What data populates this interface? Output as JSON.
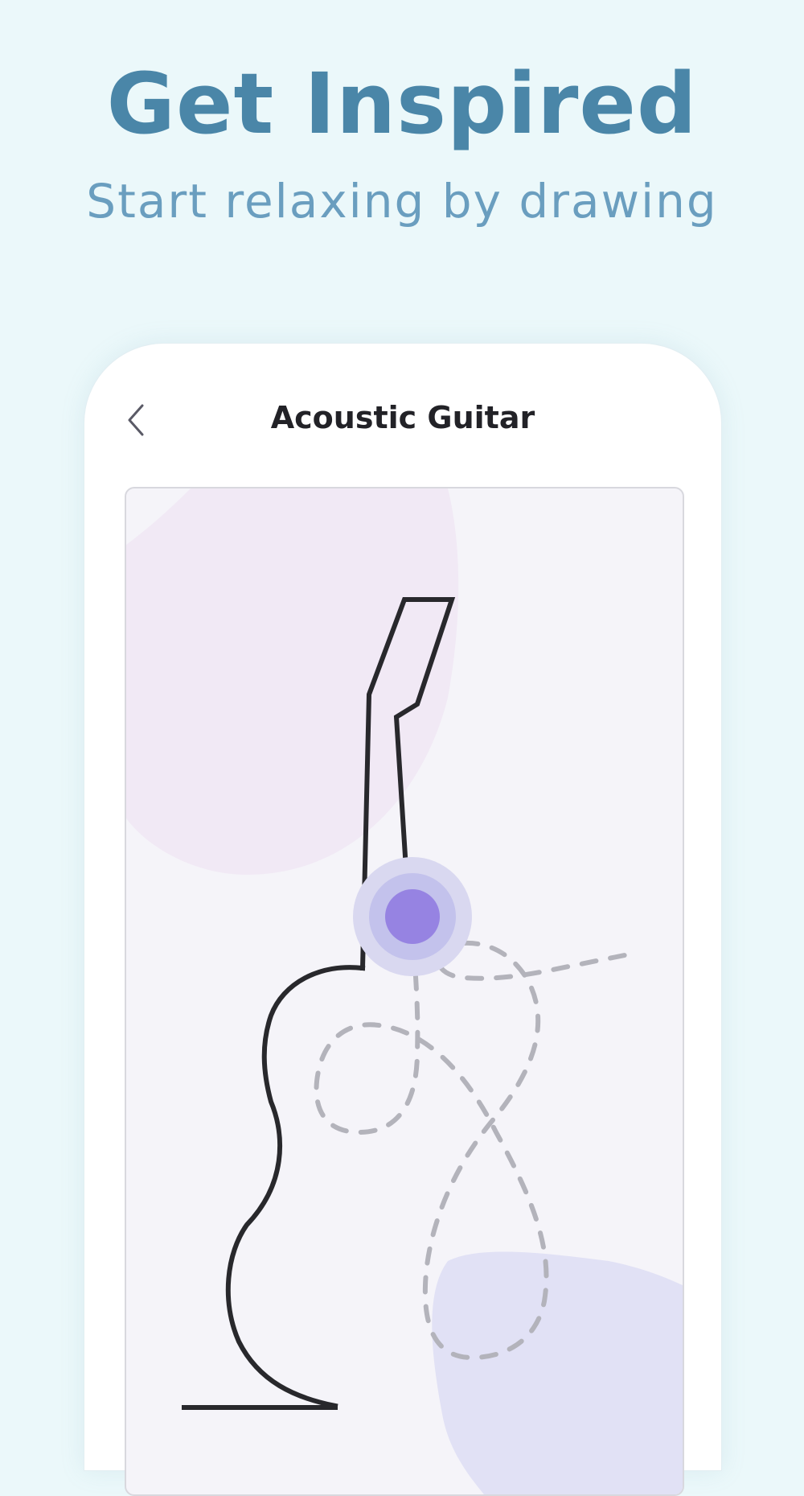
{
  "hero": {
    "title": "Get Inspired",
    "subtitle": "Start relaxing by drawing"
  },
  "app": {
    "title": "Acoustic Guitar",
    "back_icon": "chevron-left-icon"
  },
  "colors": {
    "background": "#ebf8fa",
    "title": "#4a86a8",
    "subtitle": "#6a9ebf",
    "outline": "#28282c",
    "cursor": "#9683e2",
    "guide_dash": "#b3b3bb",
    "blob_pink": "#f1e9f5",
    "blob_lavender": "#e1e1f5"
  }
}
